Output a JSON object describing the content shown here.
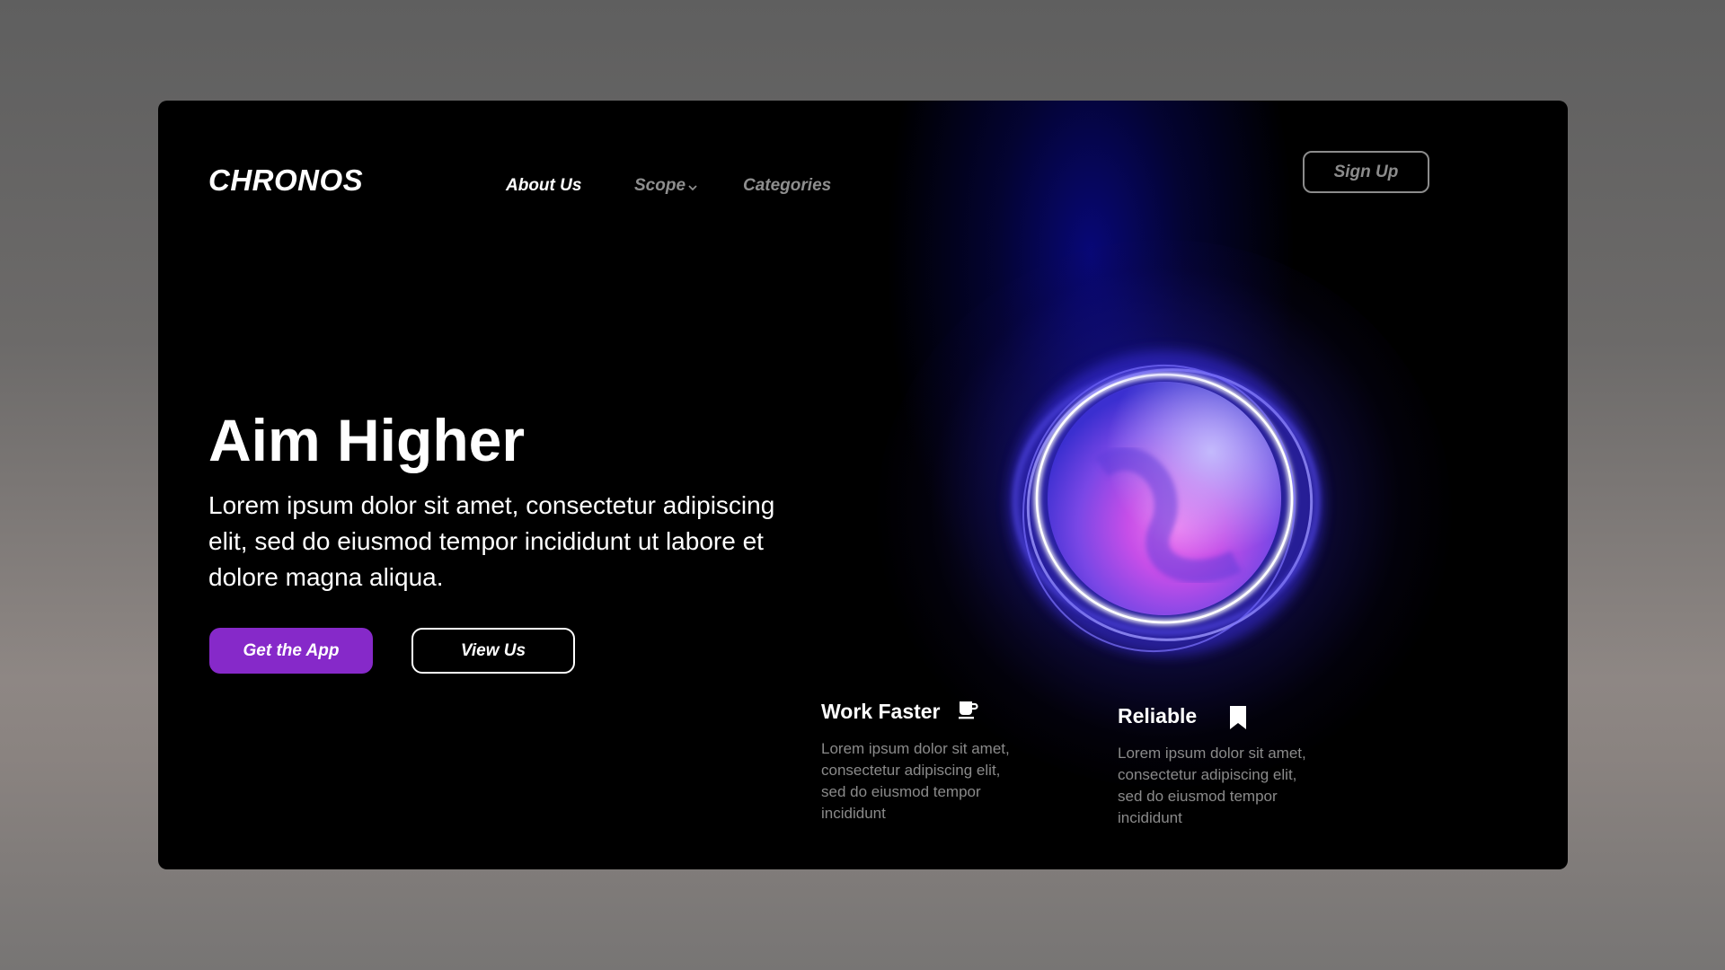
{
  "brand": {
    "name": "CHRONOS"
  },
  "nav": {
    "items": [
      {
        "label": "About Us",
        "active": true
      },
      {
        "label": "Scope",
        "has_dropdown": true
      },
      {
        "label": "Categories"
      }
    ],
    "signup_label": "Sign Up"
  },
  "hero": {
    "title": "Aim Higher",
    "body": "Lorem ipsum dolor sit amet, consectetur adipiscing elit, sed do eiusmod tempor incididunt ut labore et dolore magna aliqua.",
    "primary_button": "Get the App",
    "secondary_button": "View Us"
  },
  "features": [
    {
      "title": "Work Faster",
      "icon": "coffee-cup-icon",
      "description": "Lorem ipsum dolor sit amet, consectetur adipiscing elit, sed do eiusmod tempor incididunt"
    },
    {
      "title": "Reliable",
      "icon": "bookmark-icon",
      "description": "Lorem ipsum dolor sit amet, consectetur adipiscing elit, sed do eiusmod tempor incididunt"
    }
  ],
  "colors": {
    "background": "#000000",
    "accent": "#8629c9",
    "glow": "#2a1fd6",
    "muted_text": "#8a8a8a"
  }
}
